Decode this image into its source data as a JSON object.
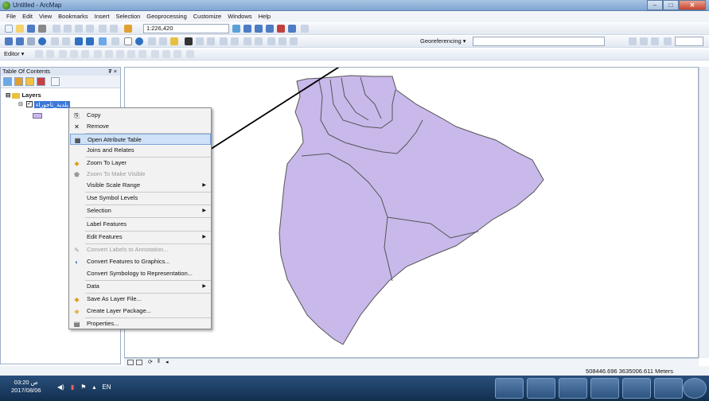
{
  "window": {
    "title": "Untitled - ArcMap"
  },
  "menubar": [
    "File",
    "Edit",
    "View",
    "Bookmarks",
    "Insert",
    "Selection",
    "Geoprocessing",
    "Customize",
    "Windows",
    "Help"
  ],
  "toolbar": {
    "scale": "1:226,420",
    "georeferencing": "Georeferencing ▾",
    "editor": "Editor ▾"
  },
  "toc": {
    "title": "Table Of Contents",
    "pin": "₮ ×",
    "layers_label": "Layers",
    "layer_name": "بلدية_تاجوراء"
  },
  "context_menu": [
    {
      "label": "Copy",
      "icon": "copy-icon",
      "disabled": false
    },
    {
      "label": "Remove",
      "icon": "remove-icon",
      "disabled": false
    },
    {
      "label": "Open Attribute Table",
      "icon": "table-icon",
      "disabled": false,
      "selected": true
    },
    {
      "label": "Joins and Relates",
      "icon": "",
      "disabled": false
    },
    {
      "label": "Zoom To Layer",
      "icon": "zoom-layer-icon",
      "disabled": false
    },
    {
      "label": "Zoom To Make Visible",
      "icon": "zoom-visible-icon",
      "disabled": true
    },
    {
      "label": "Visible Scale Range",
      "icon": "",
      "disabled": false,
      "submenu": true
    },
    {
      "label": "Use Symbol Levels",
      "icon": "",
      "disabled": false
    },
    {
      "label": "Selection",
      "icon": "",
      "disabled": false,
      "submenu": true
    },
    {
      "label": "Label Features",
      "icon": "",
      "disabled": false
    },
    {
      "label": "Edit Features",
      "icon": "",
      "disabled": false,
      "submenu": true
    },
    {
      "label": "Convert Labels to Annotation...",
      "icon": "annotation-icon",
      "disabled": true
    },
    {
      "label": "Convert Features to Graphics...",
      "icon": "graphics-icon",
      "disabled": false
    },
    {
      "label": "Convert Symbology to Representation...",
      "icon": "",
      "disabled": false
    },
    {
      "label": "Data",
      "icon": "",
      "disabled": false,
      "submenu": true
    },
    {
      "label": "Save As Layer File...",
      "icon": "save-layer-icon",
      "disabled": false
    },
    {
      "label": "Create Layer Package...",
      "icon": "package-icon",
      "disabled": false
    },
    {
      "label": "Properties...",
      "icon": "properties-icon",
      "disabled": false
    }
  ],
  "map": {
    "polygon_color": "#c9b8ea",
    "outline_color": "#555"
  },
  "status": {
    "coordinates": "508446.696  3635006.611 Meters"
  },
  "taskbar": {
    "time": "03:20 ص",
    "date": "2017/08/06",
    "lang": "EN"
  }
}
